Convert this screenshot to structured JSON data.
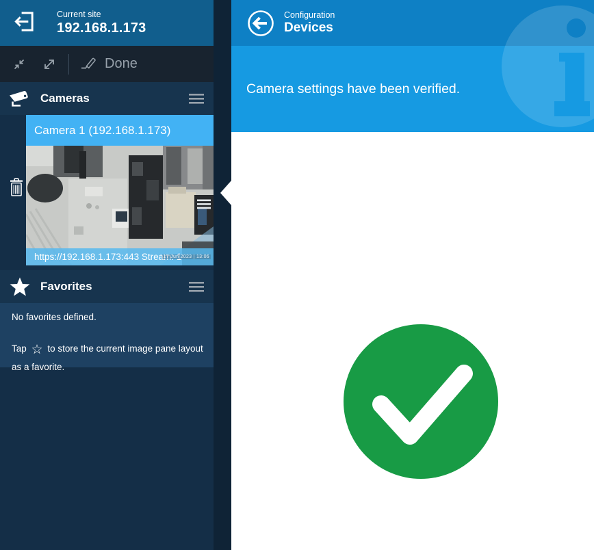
{
  "sidebar": {
    "site_header": {
      "label": "Current site",
      "value": "192.168.1.173"
    },
    "toolbar": {
      "done_label": "Done"
    },
    "cameras": {
      "title": "Cameras",
      "tile": {
        "title": "Camera 1 (192.168.1.173)",
        "caption": "https://192.168.1.173:443 Stream: 1",
        "osd_timestamp": "17 Jun 2023 | 13:06"
      }
    },
    "favorites": {
      "title": "Favorites",
      "empty_text": "No favorites defined.",
      "hint_prefix": "Tap",
      "star_glyph": "☆",
      "hint_suffix": "to store the current image pane layout as a favorite."
    }
  },
  "main": {
    "header": {
      "breadcrumb": "Configuration",
      "title": "Devices"
    },
    "banner": {
      "message": "Camera settings have been verified."
    },
    "status": "success"
  },
  "icons": {
    "exit": "exit-site-icon",
    "collapse": "collapse-panes-icon",
    "expand": "expand-panes-icon",
    "edit": "pencil-edit-icon",
    "camera": "cctv-camera-icon",
    "menu": "hamburger-menu-icon",
    "trash": "trash-icon",
    "drag": "drag-handle-icon",
    "star_filled": "star-filled-icon",
    "back": "back-circle-icon",
    "info": "info-watermark-icon",
    "check": "success-check-icon"
  },
  "colors": {
    "sidebar_bg": "#142e47",
    "site_header_blue": "#115e8d",
    "section_header": "#17344e",
    "tile_accent": "#42b2f4",
    "main_header_blue": "#0e80c5",
    "banner_blue": "#169ae2",
    "success_green": "#189b45"
  }
}
